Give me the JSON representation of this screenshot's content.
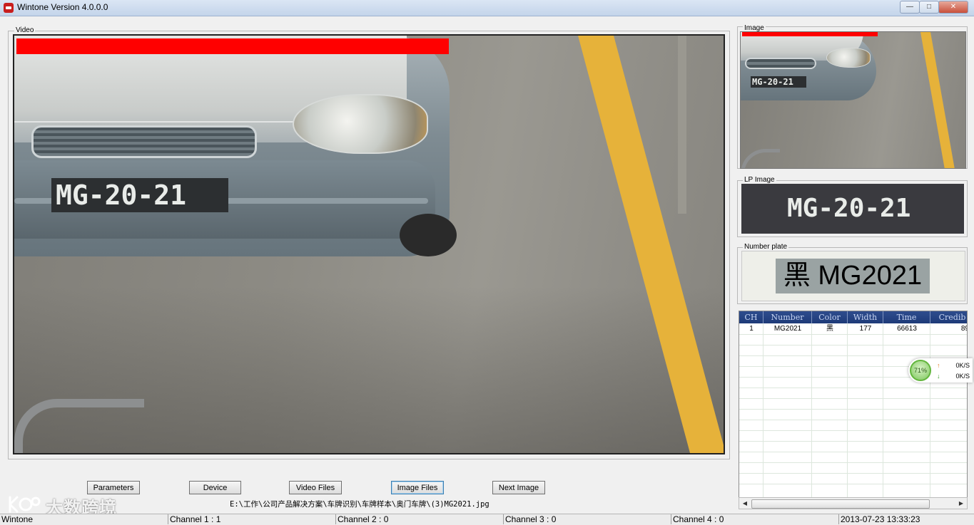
{
  "window": {
    "title": "Wintone Version 4.0.0.0",
    "controls": {
      "minimize": "—",
      "maximize": "□",
      "close": "✕"
    }
  },
  "video_panel": {
    "label": "Video",
    "plate_text": "MG-20-21"
  },
  "image_panel": {
    "label": "Image",
    "plate_text": "MG-20-21"
  },
  "lp_image_panel": {
    "label": "LP Image",
    "plate_text": "MG-20-21"
  },
  "number_plate_panel": {
    "label": "Number plate",
    "value": "黑 MG2021"
  },
  "buttons": {
    "parameters": "Parameters",
    "device": "Device",
    "video_files": "Video Files",
    "image_files": "Image Files",
    "next_image": "Next Image"
  },
  "file_path": "E:\\工作\\公司产品解决方案\\车牌识别\\车牌样本\\奥门车牌\\(3)MG2021.jpg",
  "table": {
    "columns": [
      "CH",
      "Number",
      "Color",
      "Width",
      "Time",
      "Credib"
    ],
    "rows": [
      [
        "1",
        "MG2021",
        "黑",
        "177",
        "66613",
        "89"
      ]
    ]
  },
  "speed_widget": {
    "percent": "71%",
    "up": "0K/S",
    "down": "0K/S"
  },
  "status_bar": {
    "app": "Wintone",
    "channel1": "Channel 1 : 1",
    "channel2": "Channel 2 : 0",
    "channel3": "Channel 3 : 0",
    "channel4": "Channel 4 : 0",
    "datetime": "2013-07-23 13:33:23"
  },
  "watermark": "大数跨境",
  "colors": {
    "accent_red": "#ff0000",
    "table_header": "#1e3a78",
    "lane_yellow": "#e6b23a"
  }
}
